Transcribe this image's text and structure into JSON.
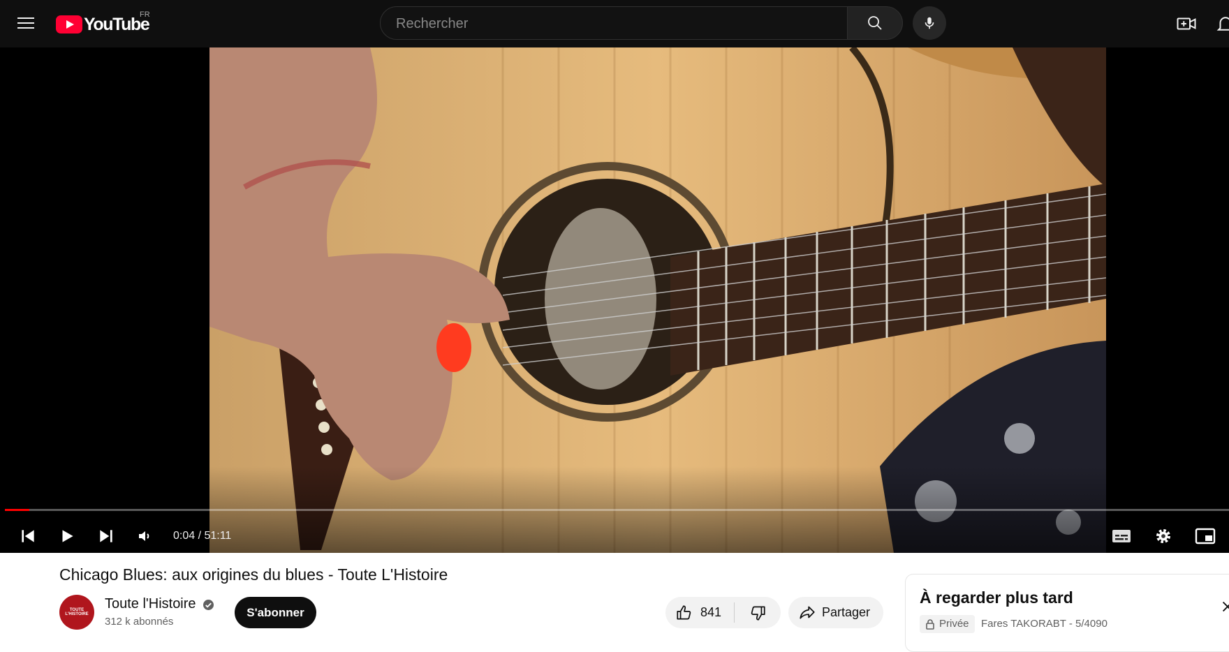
{
  "masthead": {
    "logo_text": "YouTube",
    "country_code": "FR",
    "search_placeholder": "Rechercher"
  },
  "player": {
    "time_display": "0:04 / 51:11",
    "progress_fraction": 0.0015,
    "accent_color": "#ff0000"
  },
  "video": {
    "title": "Chicago Blues: aux origines du blues - Toute L'Histoire",
    "channel_name": "Toute l'Histoire",
    "channel_avatar_text": "TOUTE L'HISTOIRE",
    "subscriber_count": "312 k abonnés",
    "subscribe_label": "S'abonner",
    "like_count": "841",
    "share_label": "Partager"
  },
  "playlist": {
    "title": "À regarder plus tard",
    "privacy_label": "Privée",
    "owner_and_position": "Fares TAKORABT - 5/4090"
  },
  "icons": [
    "menu-icon",
    "youtube-logo-icon",
    "search-icon",
    "microphone-icon",
    "create-icon",
    "notifications-icon",
    "previous-icon",
    "play-icon",
    "next-icon",
    "volume-icon",
    "subtitles-icon",
    "settings-icon",
    "miniplayer-icon",
    "verified-icon",
    "like-icon",
    "dislike-icon",
    "share-icon",
    "lock-icon",
    "close-icon"
  ]
}
